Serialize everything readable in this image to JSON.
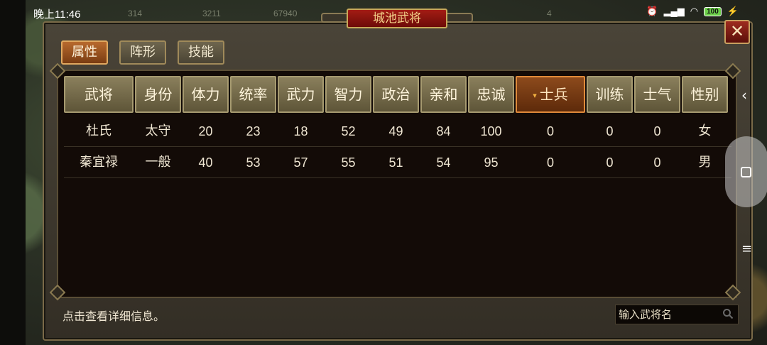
{
  "status": {
    "time": "晚上11:46",
    "resources": [
      "314",
      "3211",
      "67940",
      "4"
    ],
    "battery": "100"
  },
  "window": {
    "title": "城池武将",
    "close_label": "✕"
  },
  "tabs": [
    {
      "label": "属性",
      "active": true
    },
    {
      "label": "阵形",
      "active": false
    },
    {
      "label": "技能",
      "active": false
    }
  ],
  "table": {
    "sorted_column": "士兵",
    "sort_marker": "▾",
    "columns": [
      "武将",
      "身份",
      "体力",
      "统率",
      "武力",
      "智力",
      "政治",
      "亲和",
      "忠诚",
      "士兵",
      "训练",
      "士气",
      "性别"
    ],
    "rows": [
      [
        "杜氏",
        "太守",
        "20",
        "23",
        "18",
        "52",
        "49",
        "84",
        "100",
        "0",
        "0",
        "0",
        "女"
      ],
      [
        "秦宜禄",
        "一般",
        "40",
        "53",
        "57",
        "55",
        "51",
        "54",
        "95",
        "0",
        "0",
        "0",
        "男"
      ]
    ]
  },
  "footer": {
    "hint": "点击查看详细信息。",
    "search_placeholder": "输入武将名"
  },
  "nav": {
    "back": "‹",
    "menu": "≡"
  }
}
